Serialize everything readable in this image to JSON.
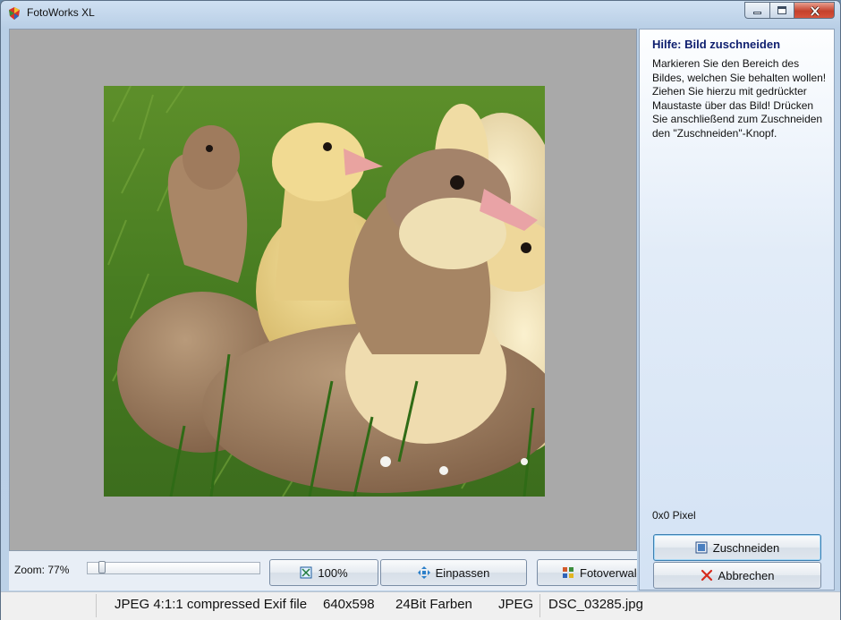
{
  "window": {
    "title": "FotoWorks XL"
  },
  "toolbar": {
    "zoom_label": "Zoom: 77%",
    "zoom_value": 0.07,
    "btn_100": "100%",
    "btn_fit": "Einpassen",
    "btn_manager": "Fotoverwal"
  },
  "help": {
    "title": "Hilfe: Bild zuschneiden",
    "text": "Markieren Sie den Bereich des Bildes, welchen Sie behalten wollen! Ziehen Sie hierzu mit gedrückter Maustaste über das Bild! Drücken Sie anschließend zum  Zuschneiden den \"Zuschneiden\"-Knopf."
  },
  "selection": {
    "size": "0x0 Pixel"
  },
  "actions": {
    "crop": "Zuschneiden",
    "cancel": "Abbrechen"
  },
  "status": {
    "format": "JPEG 4:1:1 compressed Exif file",
    "dimensions": "640x598",
    "depth": "24Bit Farben",
    "type": "JPEG",
    "filename": "DSC_03285.jpg"
  },
  "colors": {
    "help_title": "#0e1e6e",
    "canvas_bg": "#a9a9a9",
    "close_button": "#c5412c"
  }
}
